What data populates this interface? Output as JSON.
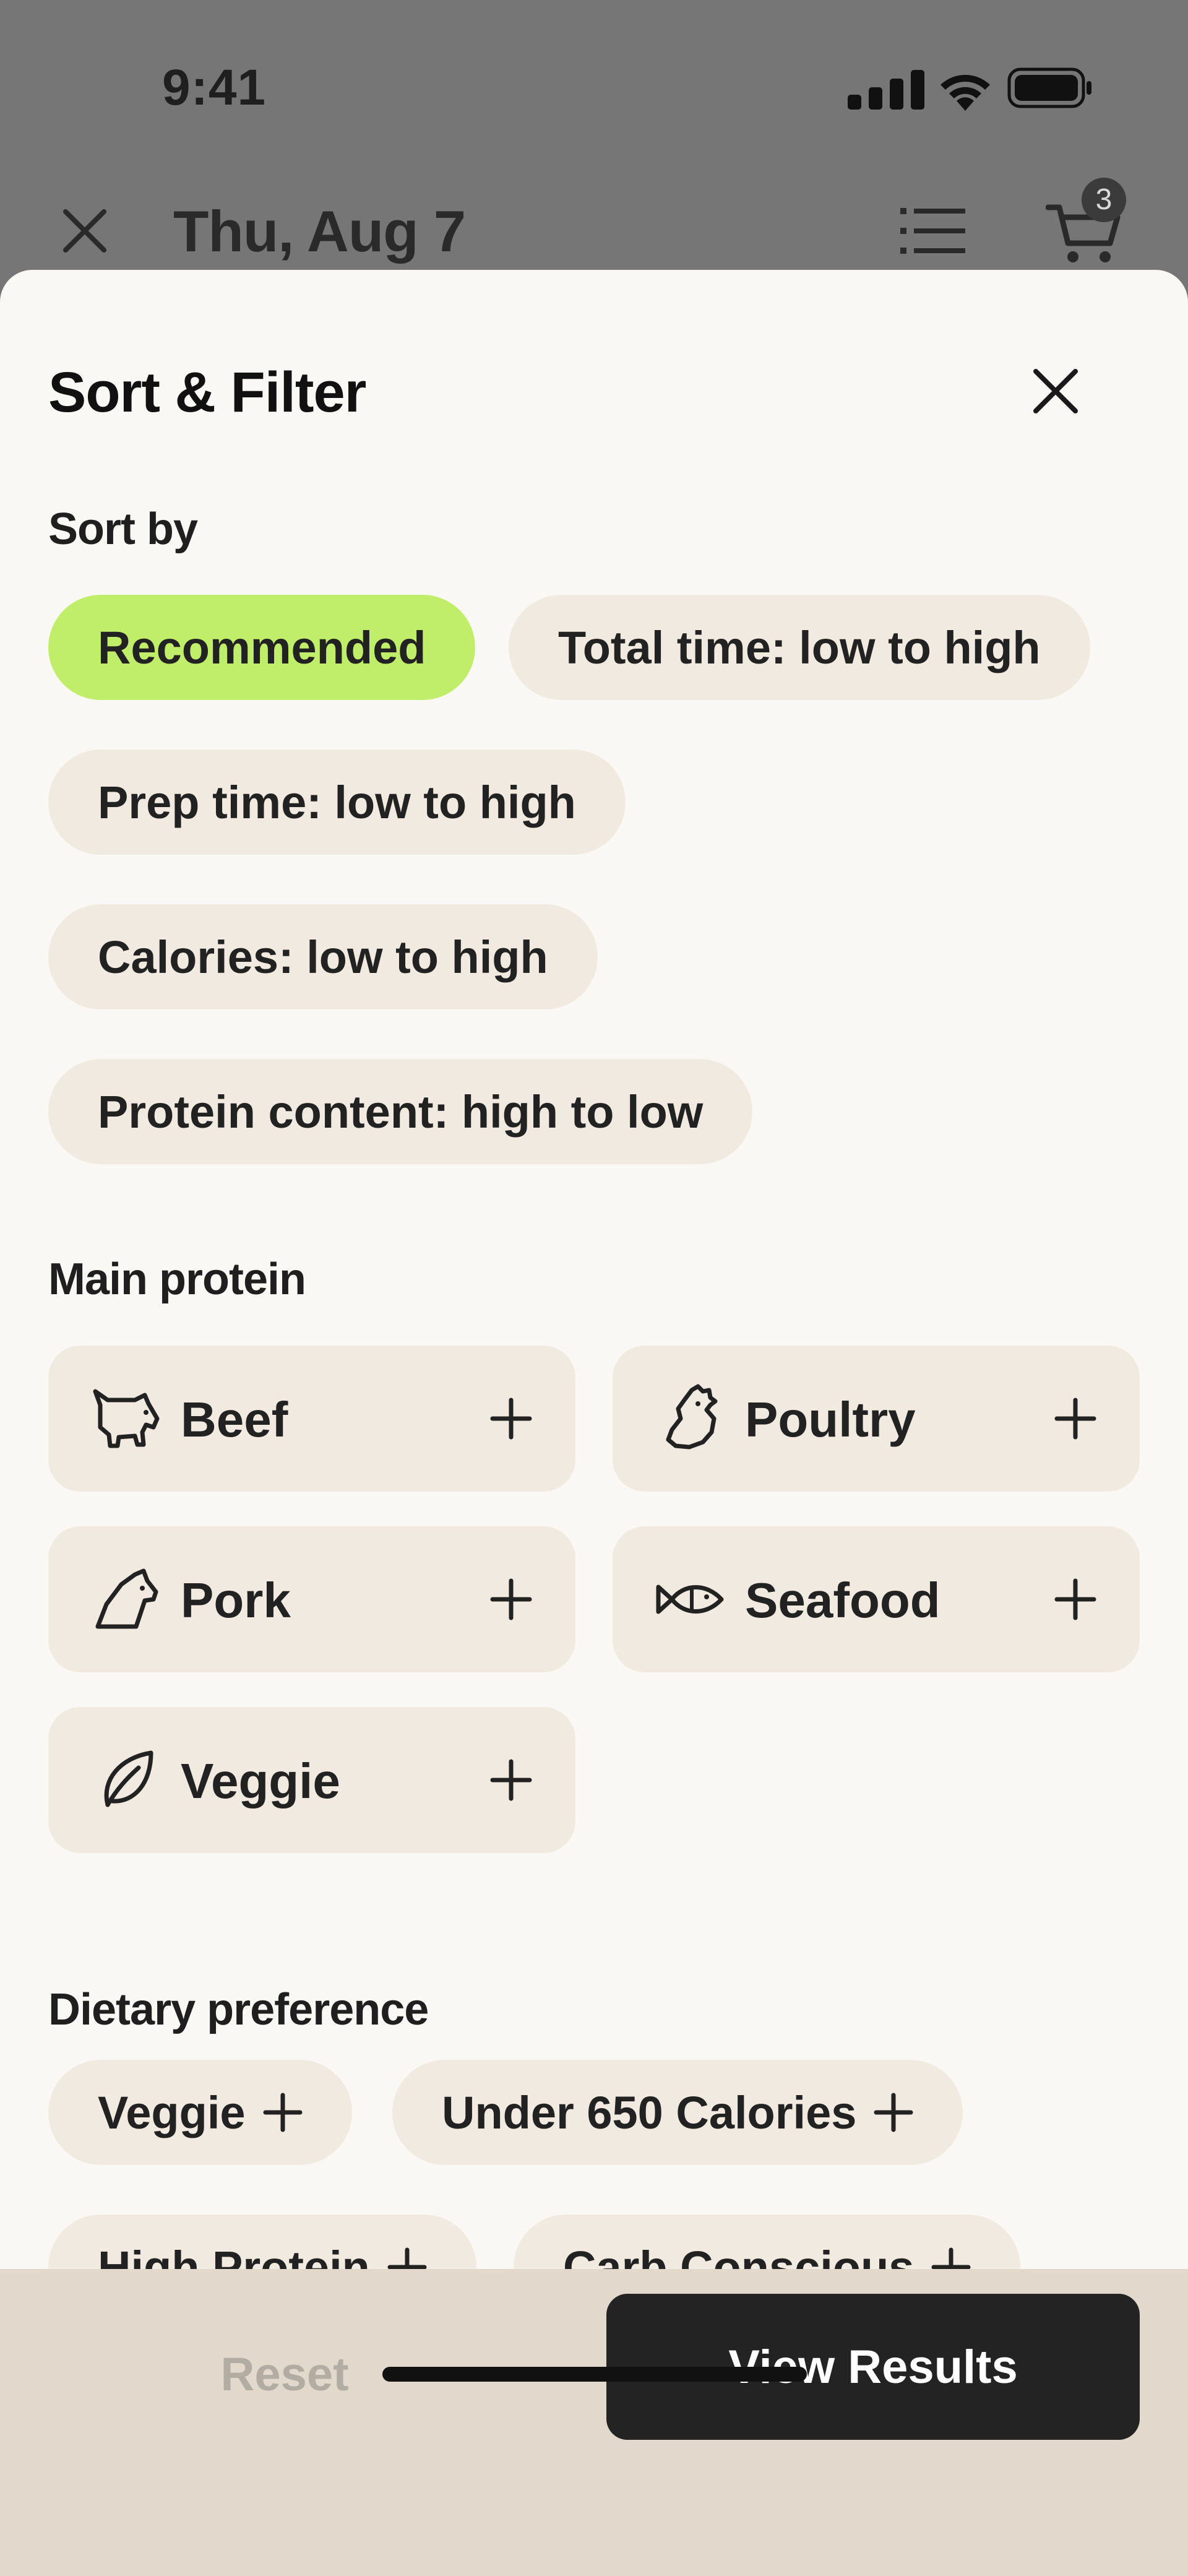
{
  "status_bar": {
    "time": "9:41"
  },
  "nav": {
    "date": "Thu, Aug 7",
    "cart_count": "3"
  },
  "sheet": {
    "title": "Sort & Filter",
    "sort_by": {
      "label": "Sort by",
      "options": [
        {
          "label": "Recommended",
          "selected": true
        },
        {
          "label": "Total time: low to high",
          "selected": false
        },
        {
          "label": "Prep time: low to high",
          "selected": false
        },
        {
          "label": "Calories: low to high",
          "selected": false
        },
        {
          "label": "Protein content: high to low",
          "selected": false
        }
      ]
    },
    "main_protein": {
      "label": "Main protein",
      "options": [
        {
          "label": "Beef",
          "icon": "beef-icon"
        },
        {
          "label": "Poultry",
          "icon": "poultry-icon"
        },
        {
          "label": "Pork",
          "icon": "pork-icon"
        },
        {
          "label": "Seafood",
          "icon": "seafood-icon"
        },
        {
          "label": "Veggie",
          "icon": "leaf-icon"
        }
      ]
    },
    "dietary_preference": {
      "label": "Dietary preference",
      "options": [
        {
          "label": "Veggie"
        },
        {
          "label": "Under 650 Calories"
        },
        {
          "label": "High Protein"
        },
        {
          "label": "Carb Conscious"
        }
      ]
    }
  },
  "actions": {
    "reset_label": "Reset",
    "view_results_label": "View Results"
  },
  "colors": {
    "selected_chip": "#c1ee6a",
    "chip": "#f0eae0",
    "sheet": "#faf8f4",
    "primary_button": "#232323"
  }
}
